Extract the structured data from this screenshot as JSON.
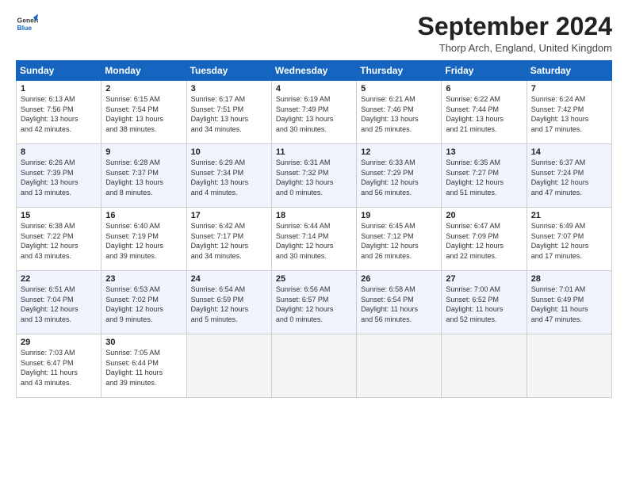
{
  "logo": {
    "line1": "General",
    "line2": "Blue"
  },
  "title": "September 2024",
  "subtitle": "Thorp Arch, England, United Kingdom",
  "weekdays": [
    "Sunday",
    "Monday",
    "Tuesday",
    "Wednesday",
    "Thursday",
    "Friday",
    "Saturday"
  ],
  "weeks": [
    [
      {
        "day": "1",
        "info": "Sunrise: 6:13 AM\nSunset: 7:56 PM\nDaylight: 13 hours\nand 42 minutes."
      },
      {
        "day": "2",
        "info": "Sunrise: 6:15 AM\nSunset: 7:54 PM\nDaylight: 13 hours\nand 38 minutes."
      },
      {
        "day": "3",
        "info": "Sunrise: 6:17 AM\nSunset: 7:51 PM\nDaylight: 13 hours\nand 34 minutes."
      },
      {
        "day": "4",
        "info": "Sunrise: 6:19 AM\nSunset: 7:49 PM\nDaylight: 13 hours\nand 30 minutes."
      },
      {
        "day": "5",
        "info": "Sunrise: 6:21 AM\nSunset: 7:46 PM\nDaylight: 13 hours\nand 25 minutes."
      },
      {
        "day": "6",
        "info": "Sunrise: 6:22 AM\nSunset: 7:44 PM\nDaylight: 13 hours\nand 21 minutes."
      },
      {
        "day": "7",
        "info": "Sunrise: 6:24 AM\nSunset: 7:42 PM\nDaylight: 13 hours\nand 17 minutes."
      }
    ],
    [
      {
        "day": "8",
        "info": "Sunrise: 6:26 AM\nSunset: 7:39 PM\nDaylight: 13 hours\nand 13 minutes."
      },
      {
        "day": "9",
        "info": "Sunrise: 6:28 AM\nSunset: 7:37 PM\nDaylight: 13 hours\nand 8 minutes."
      },
      {
        "day": "10",
        "info": "Sunrise: 6:29 AM\nSunset: 7:34 PM\nDaylight: 13 hours\nand 4 minutes."
      },
      {
        "day": "11",
        "info": "Sunrise: 6:31 AM\nSunset: 7:32 PM\nDaylight: 13 hours\nand 0 minutes."
      },
      {
        "day": "12",
        "info": "Sunrise: 6:33 AM\nSunset: 7:29 PM\nDaylight: 12 hours\nand 56 minutes."
      },
      {
        "day": "13",
        "info": "Sunrise: 6:35 AM\nSunset: 7:27 PM\nDaylight: 12 hours\nand 51 minutes."
      },
      {
        "day": "14",
        "info": "Sunrise: 6:37 AM\nSunset: 7:24 PM\nDaylight: 12 hours\nand 47 minutes."
      }
    ],
    [
      {
        "day": "15",
        "info": "Sunrise: 6:38 AM\nSunset: 7:22 PM\nDaylight: 12 hours\nand 43 minutes."
      },
      {
        "day": "16",
        "info": "Sunrise: 6:40 AM\nSunset: 7:19 PM\nDaylight: 12 hours\nand 39 minutes."
      },
      {
        "day": "17",
        "info": "Sunrise: 6:42 AM\nSunset: 7:17 PM\nDaylight: 12 hours\nand 34 minutes."
      },
      {
        "day": "18",
        "info": "Sunrise: 6:44 AM\nSunset: 7:14 PM\nDaylight: 12 hours\nand 30 minutes."
      },
      {
        "day": "19",
        "info": "Sunrise: 6:45 AM\nSunset: 7:12 PM\nDaylight: 12 hours\nand 26 minutes."
      },
      {
        "day": "20",
        "info": "Sunrise: 6:47 AM\nSunset: 7:09 PM\nDaylight: 12 hours\nand 22 minutes."
      },
      {
        "day": "21",
        "info": "Sunrise: 6:49 AM\nSunset: 7:07 PM\nDaylight: 12 hours\nand 17 minutes."
      }
    ],
    [
      {
        "day": "22",
        "info": "Sunrise: 6:51 AM\nSunset: 7:04 PM\nDaylight: 12 hours\nand 13 minutes."
      },
      {
        "day": "23",
        "info": "Sunrise: 6:53 AM\nSunset: 7:02 PM\nDaylight: 12 hours\nand 9 minutes."
      },
      {
        "day": "24",
        "info": "Sunrise: 6:54 AM\nSunset: 6:59 PM\nDaylight: 12 hours\nand 5 minutes."
      },
      {
        "day": "25",
        "info": "Sunrise: 6:56 AM\nSunset: 6:57 PM\nDaylight: 12 hours\nand 0 minutes."
      },
      {
        "day": "26",
        "info": "Sunrise: 6:58 AM\nSunset: 6:54 PM\nDaylight: 11 hours\nand 56 minutes."
      },
      {
        "day": "27",
        "info": "Sunrise: 7:00 AM\nSunset: 6:52 PM\nDaylight: 11 hours\nand 52 minutes."
      },
      {
        "day": "28",
        "info": "Sunrise: 7:01 AM\nSunset: 6:49 PM\nDaylight: 11 hours\nand 47 minutes."
      }
    ],
    [
      {
        "day": "29",
        "info": "Sunrise: 7:03 AM\nSunset: 6:47 PM\nDaylight: 11 hours\nand 43 minutes."
      },
      {
        "day": "30",
        "info": "Sunrise: 7:05 AM\nSunset: 6:44 PM\nDaylight: 11 hours\nand 39 minutes."
      },
      {
        "day": "",
        "info": ""
      },
      {
        "day": "",
        "info": ""
      },
      {
        "day": "",
        "info": ""
      },
      {
        "day": "",
        "info": ""
      },
      {
        "day": "",
        "info": ""
      }
    ]
  ]
}
